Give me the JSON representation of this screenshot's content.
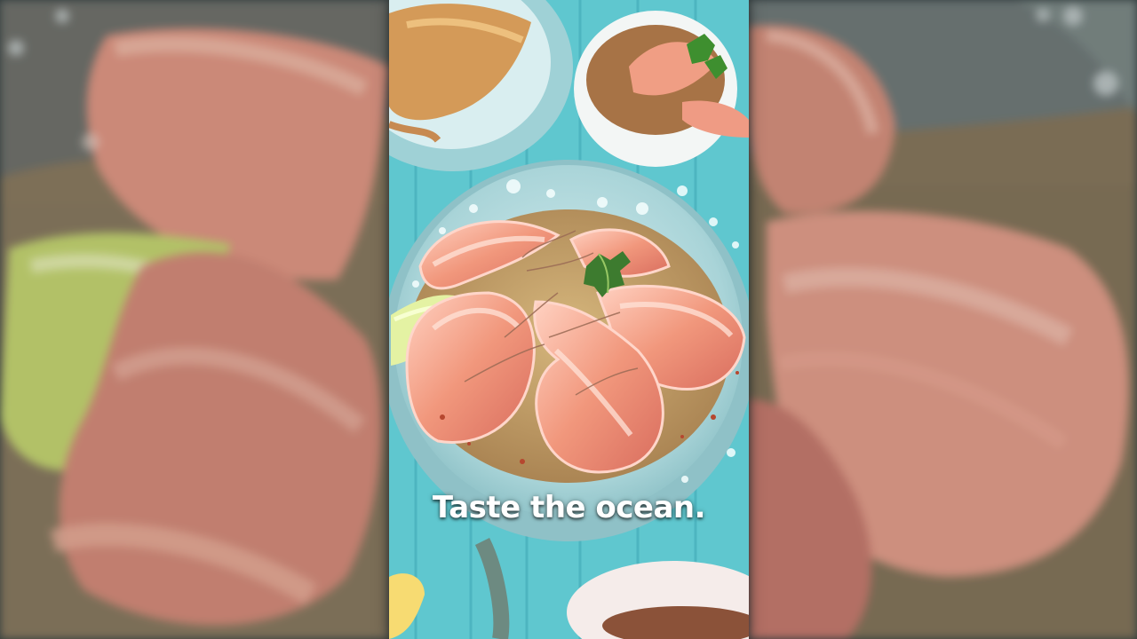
{
  "video": {
    "caption": "Taste the ocean.",
    "scene": "shrimp dish on blue plate"
  },
  "palette": {
    "table": "#5fc7cf",
    "plate": "#b9dce0",
    "sauce": "#c9a66d",
    "shrimp": "#f2a081",
    "lime": "#d8e98f",
    "herb": "#3d7b2f",
    "backdrop": "#2f3a3c"
  }
}
